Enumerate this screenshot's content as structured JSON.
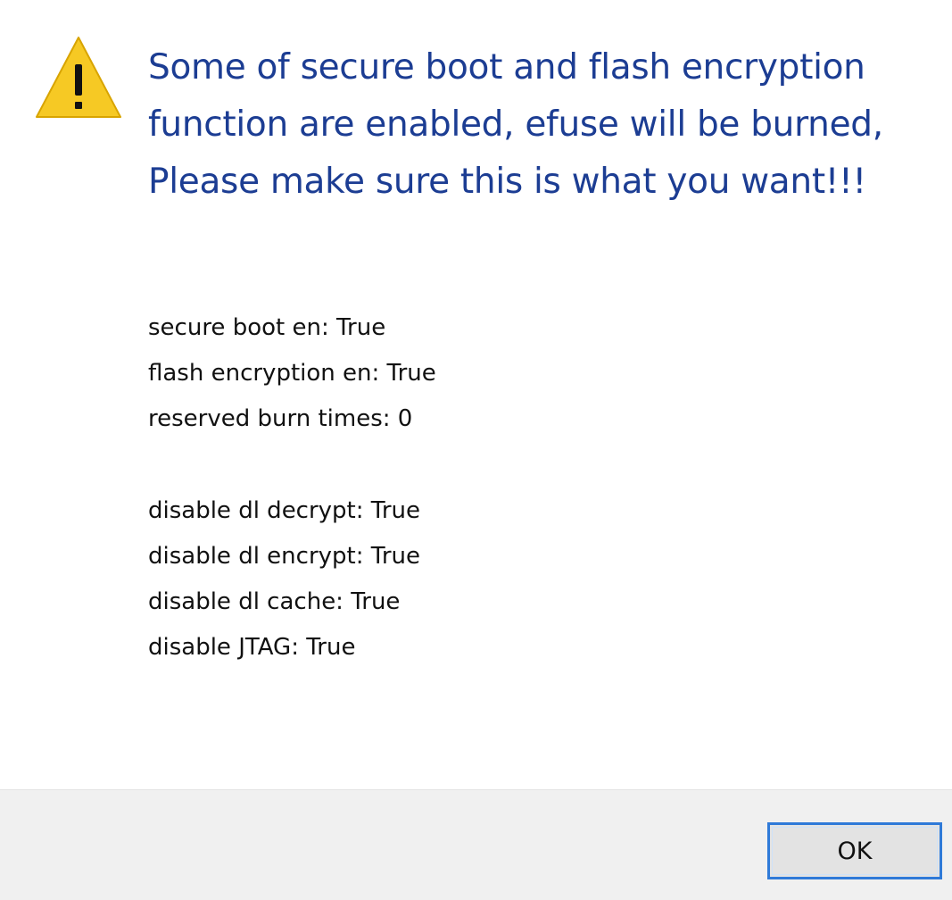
{
  "dialog": {
    "main_instruction": "Some of secure boot and flash encryption function are enabled, efuse will be burned, Please make sure this is what you want!!!",
    "icon": "warning-icon",
    "status_lines": [
      "secure boot en: True",
      "flash encryption en: True",
      "reserved burn times: 0"
    ],
    "option_lines": [
      "disable dl decrypt: True",
      "disable dl encrypt: True",
      "disable dl cache: True",
      "disable JTAG: True"
    ],
    "ok_label": "OK"
  },
  "colors": {
    "instruction_text": "#1c3d93",
    "warning_fill": "#f6c924",
    "footer_background": "#f0f0f0",
    "button_focus_border": "#2f7ad8"
  }
}
